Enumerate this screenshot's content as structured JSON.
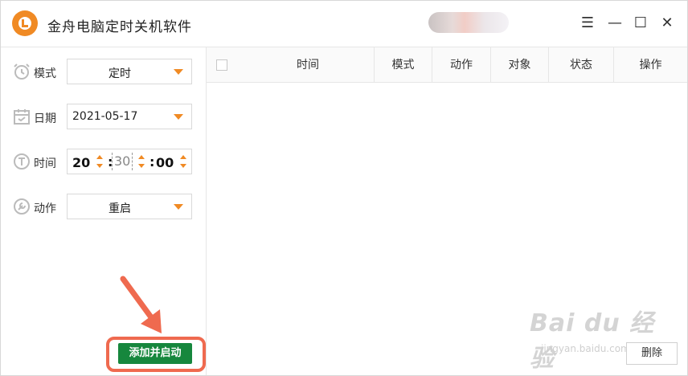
{
  "app": {
    "title": "金舟电脑定时关机软件"
  },
  "window_controls": {
    "menu": "☰",
    "minimize": "—",
    "maximize": "☐",
    "close": "✕"
  },
  "form": {
    "mode": {
      "label": "模式",
      "value": "定时"
    },
    "date": {
      "label": "日期",
      "value": "2021-05-17"
    },
    "time": {
      "label": "时间",
      "hour": "20",
      "minute": "30",
      "second": "00",
      "separator": ":"
    },
    "action": {
      "label": "动作",
      "value": "重启"
    },
    "submit_label": "添加并启动"
  },
  "table": {
    "columns": [
      "时间",
      "模式",
      "动作",
      "对象",
      "状态",
      "操作"
    ],
    "rows": []
  },
  "footer": {
    "delete_label": "删除"
  },
  "watermark": {
    "main": "Bai du 经验",
    "sub": "jingyan.baidu.com"
  },
  "colors": {
    "accent": "#f08a24",
    "primary_button": "#16873d",
    "highlight": "#ef6a4f"
  }
}
